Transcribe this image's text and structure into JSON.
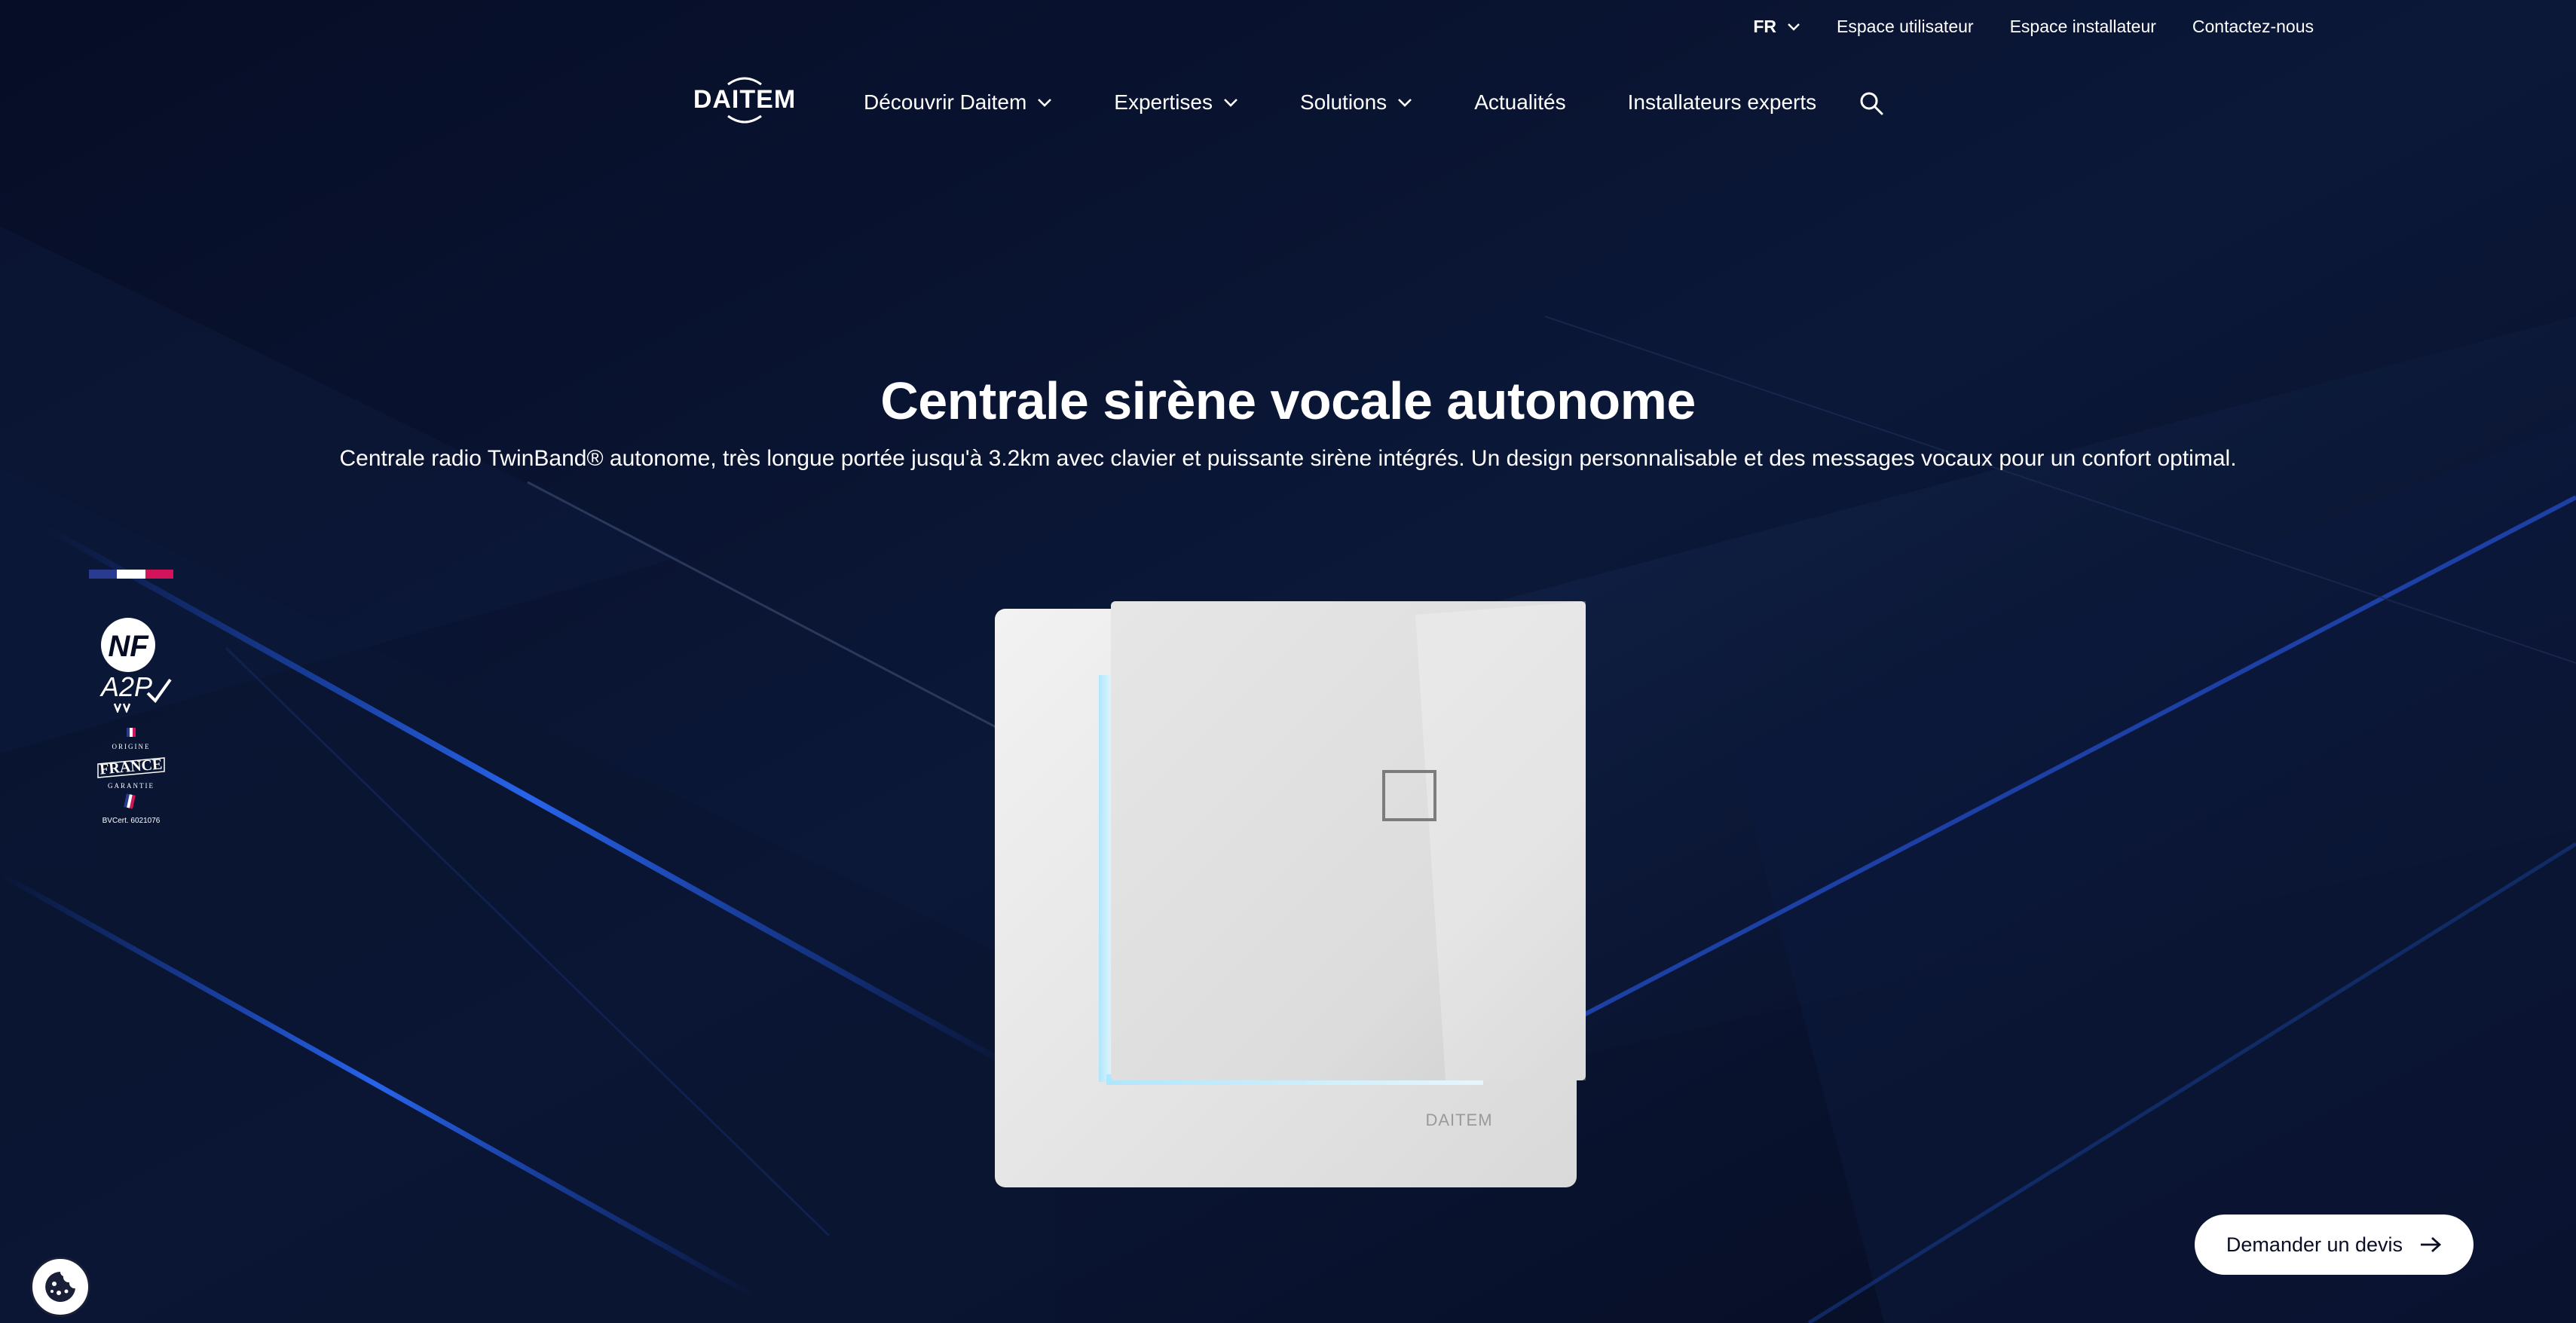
{
  "utility": {
    "lang": "FR",
    "links": [
      "Espace utilisateur",
      "Espace installateur",
      "Contactez-nous"
    ]
  },
  "nav": {
    "logo_text": "DAITEM",
    "items": [
      {
        "label": "Découvrir Daitem",
        "dropdown": true
      },
      {
        "label": "Expertises",
        "dropdown": true
      },
      {
        "label": "Solutions",
        "dropdown": true
      },
      {
        "label": "Actualités",
        "dropdown": false
      },
      {
        "label": "Installateurs experts",
        "dropdown": false
      }
    ]
  },
  "hero": {
    "title": "Centrale sirène vocale autonome",
    "subtitle": "Centrale radio TwinBand® autonome, très longue portée jusqu'à 3.2km avec clavier et puissante sirène intégrés. Un design personnalisable et des messages vocaux pour un confort optimal."
  },
  "badges": {
    "nf_text": "NF",
    "a2p_text": "A2P",
    "france_text": "FRANCE",
    "origine_text": "ORIGINE",
    "garantie_text": "GARANTIE",
    "cert_text": "BVCert. 6021076"
  },
  "product": {
    "brand_mark": "DAITEM"
  },
  "cta": {
    "label": "Demander un devis"
  },
  "colors": {
    "background": "#050c24",
    "accent_blue": "#1e5cff",
    "cta_bg": "#ffffff"
  },
  "icons": [
    "chevron-down-icon",
    "search-icon",
    "arrow-right-icon",
    "cookie-icon"
  ]
}
